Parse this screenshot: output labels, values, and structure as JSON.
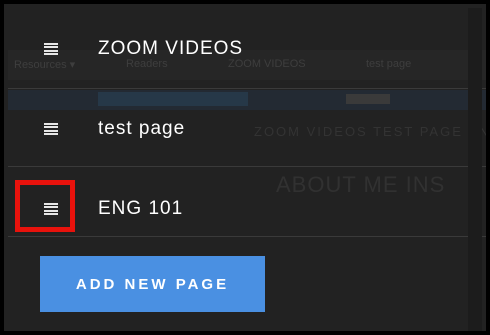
{
  "menu": {
    "items": [
      {
        "label": "ZOOM VIDEOS",
        "icon": "drag-handle-icon"
      },
      {
        "label": "test page",
        "icon": "drag-handle-icon"
      },
      {
        "label": "ENG 101",
        "icon": "drag-handle-icon"
      }
    ],
    "add_button_label": "ADD NEW PAGE"
  },
  "background": {
    "nav_items": [
      "Resources ▾",
      "Readers",
      "ZOOM VIDEOS",
      "test page"
    ],
    "menu_text": "ZOOM VIDEOS   TEST PAGE   ENG 101",
    "heading": "ABOUT ME INS"
  },
  "colors": {
    "panel": "#222222",
    "button": "#4a90e2",
    "highlight": "#e8120c",
    "text": "#ffffff"
  }
}
